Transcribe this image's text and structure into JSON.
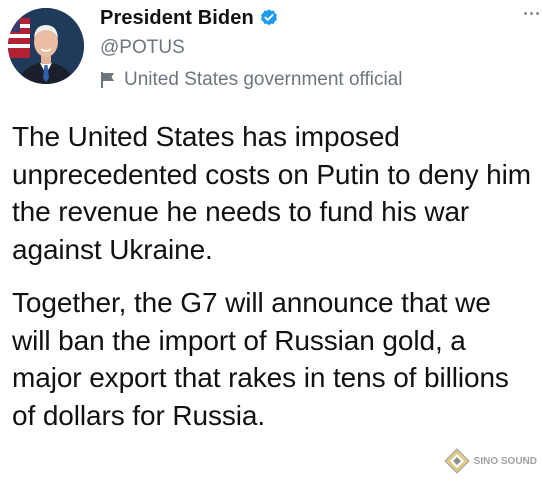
{
  "author": {
    "display_name": "President Biden",
    "handle": "@POTUS",
    "label": "United States government official",
    "verified": true,
    "avatar_icon": "avatar-photo",
    "verified_icon": "verified-badge-icon",
    "label_icon": "flag-icon"
  },
  "tweet": {
    "paragraphs": [
      "The United States has imposed unprecedented costs on Putin to deny him the revenue he needs to fund his war against Ukraine.",
      "Together, the G7 will announce that we will ban the import of Russian gold, a major export that rakes in tens of billions of dollars for Russia."
    ]
  },
  "menu": {
    "icon": "more-options-icon"
  },
  "watermark": {
    "text": "SINO SOUND"
  },
  "colors": {
    "verified_blue": "#1d9bf0",
    "secondary_text": "#6e767d",
    "primary_text": "#111111"
  }
}
